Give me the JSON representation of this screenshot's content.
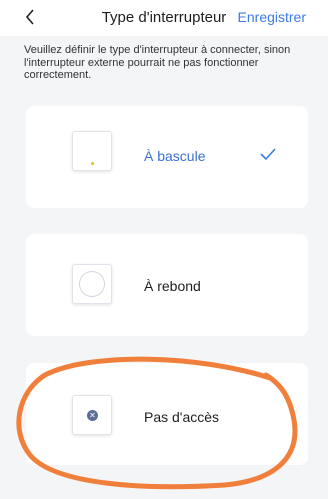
{
  "header": {
    "title": "Type d'interrupteur",
    "save_label": "Enregistrer",
    "back_icon": "chevron-left-icon"
  },
  "description": "Veuillez définir le type d'interrupteur à connecter, sinon l'interrupteur externe pourrait ne pas fonctionner correctement.",
  "options": [
    {
      "label": "À bascule",
      "icon": "toggle-switch-icon",
      "selected": true
    },
    {
      "label": "À rebond",
      "icon": "push-button-switch-icon",
      "selected": false
    },
    {
      "label": "Pas d'accès",
      "icon": "no-access-switch-icon",
      "selected": false
    }
  ],
  "colors": {
    "accent": "#3d7be6",
    "selected_label": "#3d6fd8",
    "annotation": "#f07f3c",
    "background": "#f4f5f7"
  }
}
